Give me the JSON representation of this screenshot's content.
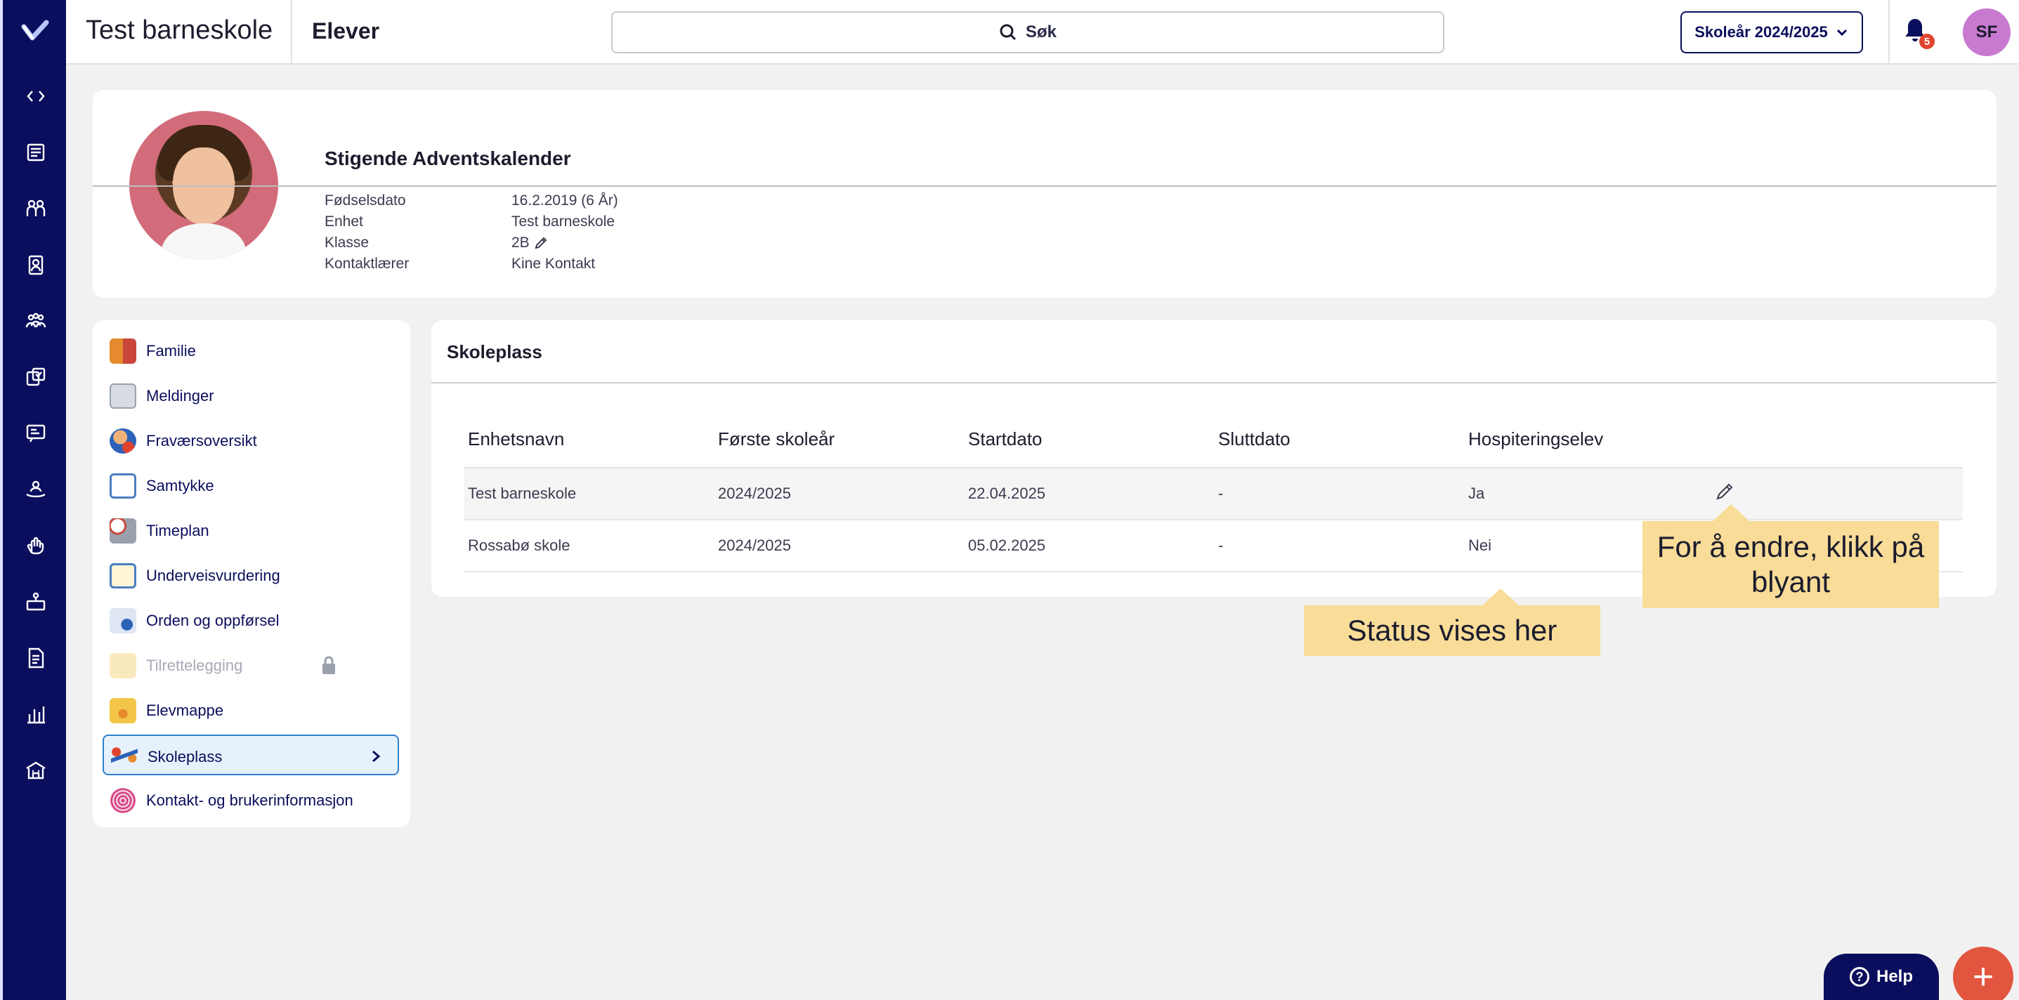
{
  "header": {
    "school": "Test barneskole",
    "section": "Elever",
    "search_label": "Søk",
    "year_label": "Skoleår 2024/2025",
    "notification_count": "5",
    "user_initials": "SF"
  },
  "rail": {
    "icons": [
      "expand-collapse-icon",
      "news-icon",
      "groups-icon",
      "badge-icon",
      "team-icon",
      "tasks-icon",
      "messages-icon",
      "activity-icon",
      "hand-icon",
      "class-icon",
      "document-icon",
      "chart-icon",
      "school-icon"
    ]
  },
  "profile": {
    "name": "Stigende Adventskalender",
    "fields": [
      {
        "label": "Fødselsdato",
        "value": "16.2.2019 (6 År)"
      },
      {
        "label": "Enhet",
        "value": "Test barneskole"
      },
      {
        "label": "Klasse",
        "value": "2B"
      },
      {
        "label": "Kontaktlærer",
        "value": "Kine Kontakt"
      }
    ]
  },
  "menu": {
    "items": [
      {
        "label": "Familie"
      },
      {
        "label": "Meldinger"
      },
      {
        "label": "Fraværsoversikt"
      },
      {
        "label": "Samtykke"
      },
      {
        "label": "Timeplan"
      },
      {
        "label": "Underveisvurdering"
      },
      {
        "label": "Orden og oppførsel"
      },
      {
        "label": "Tilrettelegging"
      },
      {
        "label": "Elevmappe"
      },
      {
        "label": "Skoleplass"
      },
      {
        "label": "Kontakt- og brukerinformasjon"
      }
    ]
  },
  "main": {
    "title": "Skoleplass",
    "columns": [
      "Enhetsnavn",
      "Første skoleår",
      "Startdato",
      "Sluttdato",
      "Hospiteringselev"
    ],
    "rows": [
      [
        "Test barneskole",
        "2024/2025",
        "22.04.2025",
        "-",
        "Ja"
      ],
      [
        "Rossabø skole",
        "2024/2025",
        "05.02.2025",
        "-",
        "Nei"
      ]
    ]
  },
  "callouts": {
    "edit": "For å endre, klikk på blyant",
    "status": "Status vises her"
  },
  "fab": {
    "help_label": "Help",
    "add_label": "+"
  },
  "colors": {
    "rail": "#0b0e5c",
    "accent": "#e2553f",
    "callout": "#f8dc97",
    "avatar": "#c77ad0"
  }
}
